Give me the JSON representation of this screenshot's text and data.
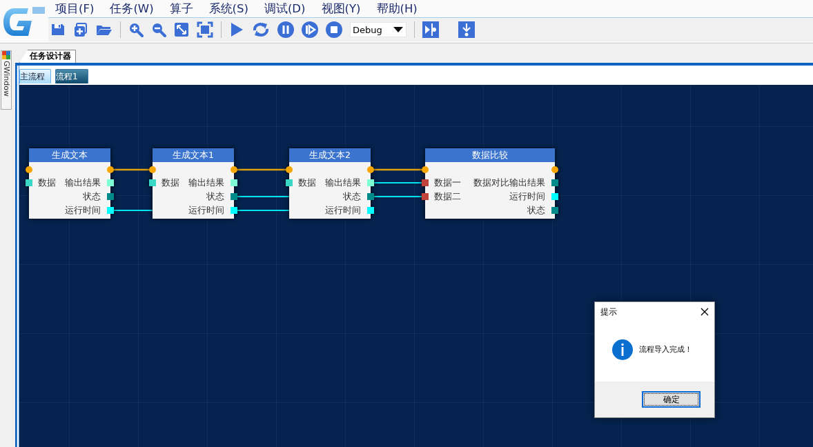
{
  "menu": [
    {
      "label": "项目(F)"
    },
    {
      "label": "任务(W)"
    },
    {
      "label": "算子"
    },
    {
      "label": "系统(S)"
    },
    {
      "label": "调试(D)"
    },
    {
      "label": "视图(Y)"
    },
    {
      "label": "帮助(H)"
    }
  ],
  "toolbar": {
    "mode": "Debug"
  },
  "side_panel": {
    "label": "GWindow"
  },
  "document_tab": {
    "label": "任务设计器"
  },
  "flow_tabs": [
    {
      "label": "主流程",
      "selected": false
    },
    {
      "label": "流程1",
      "selected": true
    }
  ],
  "nodes": [
    {
      "title": "生成文本",
      "inputs": [
        {
          "kind": "exec"
        },
        {
          "kind": "data",
          "label": "数据",
          "color": "#3ad6c6"
        }
      ],
      "outputs": [
        {
          "kind": "exec"
        },
        {
          "kind": "data",
          "label": "输出结果",
          "color": "#7fffd4"
        },
        {
          "kind": "data",
          "label": "状态",
          "color": "#008b8b"
        },
        {
          "kind": "data",
          "label": "运行时间",
          "color": "#00ffff"
        }
      ]
    },
    {
      "title": "生成文本1",
      "inputs": [
        {
          "kind": "exec"
        },
        {
          "kind": "data",
          "label": "数据",
          "color": "#3ad6c6"
        }
      ],
      "outputs": [
        {
          "kind": "exec"
        },
        {
          "kind": "data",
          "label": "输出结果",
          "color": "#7fffd4"
        },
        {
          "kind": "data",
          "label": "状态",
          "color": "#008b8b"
        },
        {
          "kind": "data",
          "label": "运行时间",
          "color": "#00ffff"
        }
      ]
    },
    {
      "title": "生成文本2",
      "inputs": [
        {
          "kind": "exec"
        },
        {
          "kind": "data",
          "label": "数据",
          "color": "#3ad6c6"
        }
      ],
      "outputs": [
        {
          "kind": "exec"
        },
        {
          "kind": "data",
          "label": "输出结果",
          "color": "#7fffd4"
        },
        {
          "kind": "data",
          "label": "状态",
          "color": "#008b8b"
        },
        {
          "kind": "data",
          "label": "运行时间",
          "color": "#00ffff"
        }
      ]
    },
    {
      "title": "数据比较",
      "inputs": [
        {
          "kind": "exec"
        },
        {
          "kind": "data",
          "label": "数据一",
          "color": "#c0443c"
        },
        {
          "kind": "data",
          "label": "数据二",
          "color": "#c0443c"
        }
      ],
      "outputs": [
        {
          "kind": "exec"
        },
        {
          "kind": "data",
          "label": "数据对比输出结果",
          "color": "#008b8b"
        },
        {
          "kind": "data",
          "label": "运行时间",
          "color": "#00ffff"
        },
        {
          "kind": "data",
          "label": "状态",
          "color": "#008b8b"
        }
      ]
    }
  ],
  "dialog": {
    "title": "提示",
    "message": "流程导入完成！",
    "button": "确定"
  }
}
